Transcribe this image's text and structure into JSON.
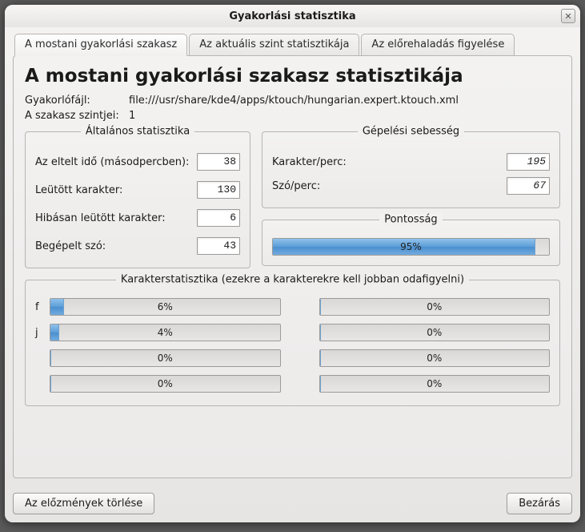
{
  "window": {
    "title": "Gyakorlási statisztika"
  },
  "tabs": {
    "t0": "A mostani gyakorlási szakasz",
    "t1": "Az aktuális szint statisztikája",
    "t2": "Az előrehaladás figyelése"
  },
  "heading": "A mostani gyakorlási szakasz statisztikája",
  "meta": {
    "file_label": "Gyakorlófájl:",
    "file_value": "file:///usr/share/kde4/apps/ktouch/hungarian.expert.ktouch.xml",
    "levels_label": "A szakasz szintjei:",
    "levels_value": "1"
  },
  "general": {
    "legend": "Általános statisztika",
    "elapsed_label": "Az eltelt idő (másodpercben):",
    "elapsed_value": "38",
    "typed_label": "Leütött karakter:",
    "typed_value": "130",
    "wrong_label": "Hibásan leütött karakter:",
    "wrong_value": "6",
    "words_label": "Begépelt szó:",
    "words_value": "43"
  },
  "speed": {
    "legend": "Gépelési sebesség",
    "cpm_label": "Karakter/perc:",
    "cpm_value": "195",
    "wpm_label": "Szó/perc:",
    "wpm_value": "67"
  },
  "accuracy": {
    "legend": "Pontosság",
    "value": "95%",
    "width": "95%"
  },
  "charstats": {
    "legend": "Karakterstatisztika (ezekre a karakterekre kell jobban odafigyelni)",
    "left": [
      {
        "char": "f",
        "label": "6%",
        "width": "6%"
      },
      {
        "char": "j",
        "label": "4%",
        "width": "4%"
      },
      {
        "char": "",
        "label": "0%",
        "width": "0%"
      },
      {
        "char": "",
        "label": "0%",
        "width": "0%"
      }
    ],
    "right": [
      {
        "char": "",
        "label": "0%",
        "width": "0%"
      },
      {
        "char": "",
        "label": "0%",
        "width": "0%"
      },
      {
        "char": "",
        "label": "0%",
        "width": "0%"
      },
      {
        "char": "",
        "label": "0%",
        "width": "0%"
      }
    ]
  },
  "buttons": {
    "clear": "Az előzmények törlése",
    "close": "Bezárás"
  }
}
